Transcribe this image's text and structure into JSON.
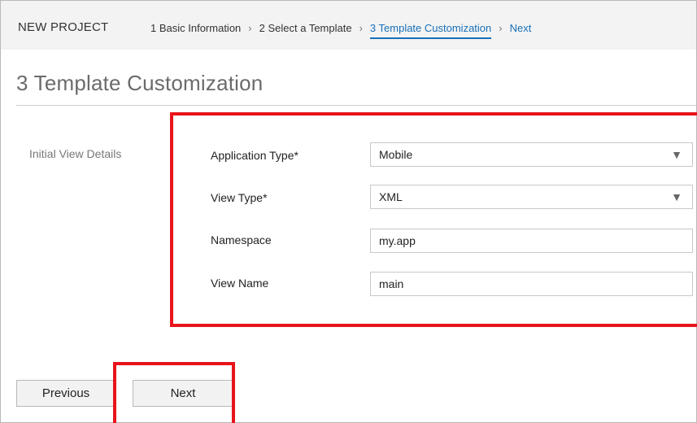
{
  "wizard": {
    "project_label": "NEW PROJECT",
    "steps": [
      {
        "label": "1 Basic Information"
      },
      {
        "label": "2 Select a Template"
      },
      {
        "label": "3 Template Customization"
      },
      {
        "label": "Next"
      }
    ],
    "separator": "›"
  },
  "page": {
    "title": "3 Template Customization",
    "section_label": "Initial View Details"
  },
  "form": {
    "application_type": {
      "label": "Application Type*",
      "value": "Mobile"
    },
    "view_type": {
      "label": "View Type*",
      "value": "XML"
    },
    "namespace": {
      "label": "Namespace",
      "value": "my.app"
    },
    "view_name": {
      "label": "View Name",
      "value": "main"
    },
    "dropdown_arrow": "▼"
  },
  "buttons": {
    "previous": "Previous",
    "next": "Next"
  },
  "colors": {
    "accent": "#1870b9",
    "highlight": "#e8141b"
  }
}
